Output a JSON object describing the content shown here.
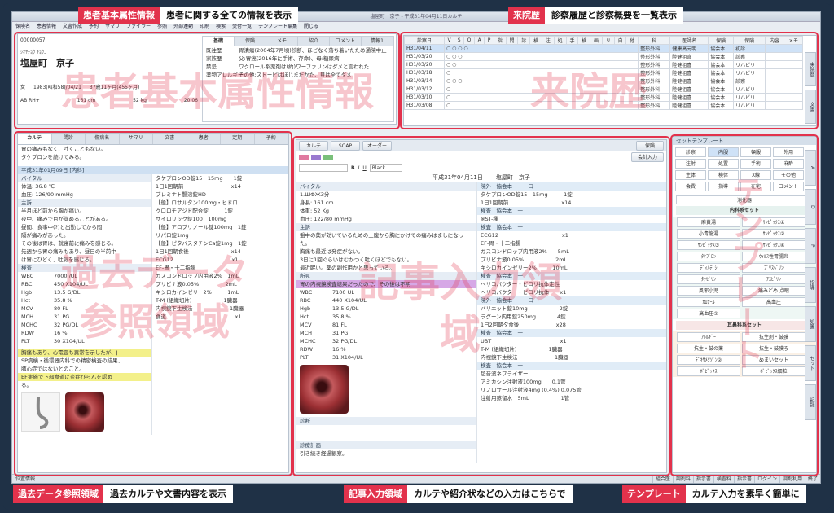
{
  "app": {
    "title": "塩屋町　京子 - 平成31年04月11日カルテ",
    "menu": [
      "保険名",
      "患者情報",
      "文書作成",
      "予約",
      "サマリ",
      "ファイラー",
      "参照",
      "外部連動",
      "印刷",
      "検索",
      "受付一覧",
      "テンプレート編集",
      "閉じる"
    ]
  },
  "annotations": {
    "patient": {
      "title": "患者基本属性情報",
      "desc": "患者に関する全ての情報を表示",
      "watermark": "患者基本属性情報"
    },
    "visits": {
      "title": "来院歴",
      "desc": "診察履歴と診察概要を一覧表示",
      "watermark": "来院歴"
    },
    "past": {
      "title": "過去データ参照領域",
      "desc": "過去カルテや文書内容を表示",
      "watermark": "過去データ参照領域"
    },
    "entry": {
      "title": "記事入力領域",
      "desc": "カルテや紹介状などの入力はこちらで",
      "watermark": "記事入力領域"
    },
    "template": {
      "title": "テンプレート",
      "desc": "カルテ入力を素早く簡単に",
      "watermark": "テンプレート"
    }
  },
  "patient": {
    "id": "00000057",
    "kana": "ｼｵﾔﾁｮｳ ｷｮｳｺ",
    "name": "塩屋町　京子",
    "gender": "女",
    "birth": "1983(昭和58)/04/21",
    "age": "37歳11ヶ月(455ヶ月)",
    "blood": "AB RH+",
    "height": "161 cm",
    "weight": "52 kg",
    "bmi": "20.06",
    "tabs": [
      "基礎",
      "保険",
      "メモ",
      "紹介",
      "コメント",
      "情報1"
    ],
    "info_rows": [
      {
        "k": "既往歴",
        "v": "胃潰瘍(2004年7月頃)診断、ほどなく落ち着いたため通院中止"
      },
      {
        "k": "家族歴",
        "v": "父:胃癌(2016年に手術、存命)、母:糖尿病"
      },
      {
        "k": "禁忌",
        "v": "ワクロール系薬剤は(約)ワーファリンはダメと言われた"
      },
      {
        "k": "薬物アレルギー",
        "v": "その他:ストーピはほじまだかた、貝は全てダメ"
      }
    ]
  },
  "visits": {
    "headers": [
      "診察日",
      "V",
      "S",
      "O",
      "A",
      "P",
      "指",
      "問",
      "診",
      "検",
      "注",
      "処",
      "手",
      "検",
      "画",
      "リ",
      "自",
      "他",
      "科",
      "医師名",
      "保険",
      "保険",
      "内容",
      "メモ"
    ],
    "rows": [
      {
        "date": "H31/04/11",
        "dept": "整形外科",
        "doctor": "健康高元明",
        "ins": "協会本",
        "content": "初診",
        "marks": "○ ○ ○ ○",
        "sel": true
      },
      {
        "date": "H31/03/20",
        "dept": "整形外科",
        "doctor": "陸健狙喜",
        "ins": "協会本",
        "content": "診察",
        "marks": "○ ○ ○",
        "sel": false
      },
      {
        "date": "H31/03/20",
        "dept": "整形外科",
        "doctor": "陸健狙喜",
        "ins": "協会本",
        "content": "リハビリ",
        "marks": "○ ○",
        "sel": false
      },
      {
        "date": "H31/03/18",
        "dept": "整形外科",
        "doctor": "陸健狙喜",
        "ins": "協会本",
        "content": "リハビリ",
        "marks": "○",
        "sel": false
      },
      {
        "date": "H31/03/14",
        "dept": "整形外科",
        "doctor": "陸健狙喜",
        "ins": "協会本",
        "content": "診察",
        "marks": "○ ○ ○",
        "sel": false
      },
      {
        "date": "H31/03/12",
        "dept": "整形外科",
        "doctor": "陸健狙喜",
        "ins": "協会本",
        "content": "リハビリ",
        "marks": "○",
        "sel": false
      },
      {
        "date": "H31/03/10",
        "dept": "整形外科",
        "doctor": "陸健狙喜",
        "ins": "協会本",
        "content": "リハビリ",
        "marks": "○",
        "sel": false
      },
      {
        "date": "H31/03/08",
        "dept": "整形外科",
        "doctor": "陸健狙喜",
        "ins": "協会本",
        "content": "リハビリ",
        "marks": "○",
        "sel": false
      }
    ],
    "side_tabs": [
      "来院歴",
      "文書"
    ]
  },
  "past": {
    "tabs": [
      "カルテ",
      "問診",
      "傷病名",
      "サマリ",
      "文書",
      "患者",
      "定期",
      "予約"
    ],
    "top_lines": [
      "胃の痛みもなく、吐くこともない。",
      "タケプロンを続けてみる。"
    ],
    "date_header": "平成31年01月09日 [内科]",
    "vital_title": "バイタル",
    "vitals": [
      "体温: 36.8 ℃",
      "血圧: 126/90 mmHg"
    ],
    "subj_title": "主訴",
    "subj_lines": [
      "半月ほど前から胸が痛い。",
      "夜中、痛みで目が覚めることがある。",
      "昼間、食事中(?)と出勤してから間",
      "隔が痛みがあった。",
      "",
      "その後は胃は、就寝前に痛みを感じる。",
      "",
      "先週から胃の痛みもあり、昼日の半前中",
      "は胃にひどく、吐気を感じる。"
    ],
    "lab_title": "検査",
    "labs": [
      [
        "WBC",
        "7000 /UL"
      ],
      [
        "RBC",
        "450 X104/UL"
      ],
      [
        "Hgb",
        "13.5 G/DL"
      ],
      [
        "Hct",
        "35.8 %"
      ],
      [
        "MCV",
        "80 FL"
      ],
      [
        "MCH",
        "31 PG"
      ],
      [
        "MCHC",
        "32 PG/DL"
      ],
      [
        "RDW",
        "16 %"
      ],
      [
        "PLT",
        "30 X104/UL"
      ]
    ],
    "notes": [
      "胸痛もあり、心電図も異常を示したが、J",
      "SP病検・循環器内科での精密検査の結果、",
      "肺心症ではないとのこと。",
      "",
      "EF実施で下部食道に炎症びらんを認め",
      "る。"
    ],
    "rx_lines": [
      "タケプロンOD錠15　15mg　　1錠",
      "1日1回朝前　　　　　　　　　x14",
      "ブレミナト腸溶錠HD",
      "【般】ロサルタン100mg・ヒドロ",
      "クロロチアジド配合錠　　　1錠",
      "ザイロリック錠100　100mg",
      "【般】アロプリノール錠100mg　1錠",
      "リパロ錠1mg",
      "【般】ピタバスタチンCa錠1mg　1錠",
      "1日1回朝食後　　　　　　　　x14",
      "ECG12　　　　　　　　　　　x1",
      "EF-胃・十二指腸",
      "ガスコンドロップ内用液2%　1mL",
      "プリビナ液0.05%　　　　　2mL",
      "キシロカインゼリー2%　　　1mL",
      "T-M (組織切片)　　　　　　1臓器",
      "内視鏡下生検法　　　　　　　1臓器",
      "食道　　　　　　　　　　　　　x1"
    ]
  },
  "entry": {
    "tabs": [
      "カルテ",
      "SOAP",
      "オーダー"
    ],
    "save": "保険",
    "accounting": "会計入力",
    "font_select": "Black",
    "date": "平成31年04月11日",
    "patient_name": "塩屋町　京子",
    "vital_title": "バイタル",
    "vitals": [
      "1.ШФЖЗ分",
      "身長: 161 cm",
      "体重: 52 Kg",
      "血圧: 122/80 mmHg"
    ],
    "subj_title": "主訴",
    "subj_lines": [
      "盤中の薬が効いているための上腹から胸にかけての痛みはましになった。",
      "",
      "胸痛も最近は発症がない。",
      "3日に1回ぐらいはむかつく吐くほどでもない。",
      "",
      "最近眠い。薬の副作用かと思っている。"
    ],
    "find_title": "所見",
    "find_line": "胃の内視鏡検査結果だったので、その後は不明",
    "labs": [
      [
        "WBC",
        "7100 UL"
      ],
      [
        "RBC",
        "440 X104/UL"
      ],
      [
        "Hgb",
        "13.5 G/DL"
      ],
      [
        "Hct",
        "35.8 %"
      ],
      [
        "MCV",
        "81 FL"
      ],
      [
        "MCH",
        "31 PG"
      ],
      [
        "MCHC",
        "32 PG/DL"
      ],
      [
        "RDW",
        "16 %"
      ],
      [
        "PLT",
        "31 X104/UL"
      ]
    ],
    "diag_title": "診断",
    "plan_title": "診療計画",
    "plan_line": "引き続き経過観察。",
    "order_lines": [
      {
        "t": "院外　協会本　一　口",
        "kind": "hdr"
      },
      {
        "t": "タケプロンOD錠15　15mg　　　1錠",
        "kind": "row"
      },
      {
        "t": "1日1回朝前　　　　　　　　　　x14",
        "kind": "row"
      },
      {
        "t": "検査　協会本　一",
        "kind": "hdr"
      },
      {
        "t": "※ST-種",
        "kind": "row"
      },
      {
        "t": "検査　協会本　一",
        "kind": "hdr"
      },
      {
        "t": "ECG12　　　　　　　　　　　　x1",
        "kind": "row"
      },
      {
        "t": "EF-胃・十二指腸",
        "kind": "row"
      },
      {
        "t": "ガスコンドロップ内用液2%　　5mL",
        "kind": "row"
      },
      {
        "t": "プリビナ液0.05%　　　　　　2mL",
        "kind": "row"
      },
      {
        "t": "キシロカインゼリー2%　　　10mL",
        "kind": "row"
      },
      {
        "t": "検査　協会本　一",
        "kind": "hdr"
      },
      {
        "t": "ヘリコバクター・ピロリ抗体定性",
        "kind": "row"
      },
      {
        "t": "ヘリコバクター・ピロリ抗体　　x1",
        "kind": "row"
      },
      {
        "t": "院外　協会本　一　口",
        "kind": "hdr"
      },
      {
        "t": "バリエット錠10mg　　　　　　2錠",
        "kind": "row"
      },
      {
        "t": "ラグーン内用錠250mg　　　　4錠",
        "kind": "row"
      },
      {
        "t": "1日2回朝夕食後　　　　　　　x28",
        "kind": "row"
      },
      {
        "t": "検査　協会本　一",
        "kind": "hdr"
      },
      {
        "t": "UBT　　　　　　　　　　　　　x1",
        "kind": "row"
      },
      {
        "t": "T-M (組織切片)　　　　　　1臓器",
        "kind": "row"
      },
      {
        "t": "内視鏡下生検法　　　　　　　1臓器",
        "kind": "row"
      },
      {
        "t": "検査　協会本　一",
        "kind": "hdr"
      },
      {
        "t": "超音波ネブライザー",
        "kind": "row"
      },
      {
        "t": "アミカシン注射液100mg　　0.1管",
        "kind": "row"
      },
      {
        "t": "リノロサール注射液4mg (0.4%) 0.075管",
        "kind": "row"
      },
      {
        "t": "注射用蒸留水　5mL　　　　　　1管",
        "kind": "row"
      }
    ]
  },
  "template": {
    "title": "セットテンプレート",
    "buttons": [
      "診察",
      "内服",
      "頓服",
      "外用",
      "注射",
      "処置",
      "手術",
      "麻酔",
      "生体",
      "検体",
      "X線",
      "その他",
      "会費",
      "指導",
      "在宅",
      "コメント"
    ],
    "section1": "消化器",
    "section2": "内科系セット",
    "items": [
      "麻黄湯",
      "ｻﾝﾋﾟｯｸｽ①",
      "小青龍湯",
      "ｻﾝﾋﾟｯｸｽ②",
      "ｻﾝﾋﾟｯｸｽ③",
      "ｻﾝﾋﾟｯｸｽ④",
      "ﾀｹﾌﾟﾛﾝ",
      "ｳｨﾙｽ性胃腸炎",
      "ﾃﾞｨﾙﾃﾞｼ",
      "ﾌﾟﾘｽﾍﾟﾘﾝ",
      "ﾀｸｾﾞﾘﾝ",
      "ｱｽﾋﾟﾘﾝ",
      "風邪小児",
      "痛みどめ 点眼",
      "ｶﾛﾅｰﾙ",
      "高血圧",
      "高血圧②"
    ],
    "section3": "耳鼻科系セット",
    "items2": [
      "ｱﾚﾙｷﾞｰ",
      "抗生剤・鼓膜",
      "抗生・鼓の薬",
      "抗生・鼓膜ろ",
      "ﾃﾞｷｻﾒﾀｿﾞﾝ②",
      "めまいセット",
      "ﾎﾞﾋﾞｯｸｽ",
      "ﾎﾞﾋﾞｯｸｽ細粒"
    ],
    "side_tabs": [
      "A",
      "D",
      "P",
      "指導",
      "処置",
      "セット",
      "記録"
    ]
  },
  "status": {
    "left": "位置情報",
    "cells": [
      "組合医",
      "調剤料",
      "指示書",
      "検査料",
      "指示書",
      "ログイン",
      "調剤利用",
      "終了"
    ]
  }
}
